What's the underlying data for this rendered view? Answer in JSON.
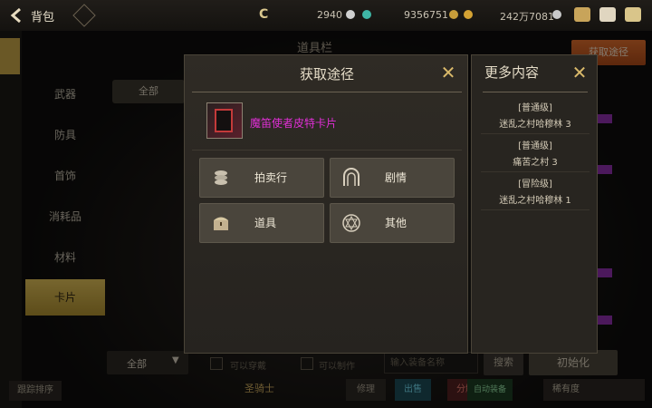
{
  "topbar": {
    "title": "背包",
    "currency_symbol": "C",
    "currencies": [
      {
        "value": "2940",
        "gem_color": "#d0d0d0"
      },
      {
        "value": "9356751",
        "gem_color": "#3fb6a6"
      },
      {
        "value": "242万7081",
        "gem_color": "#d4a233"
      }
    ],
    "icons": [
      "back-arrow-icon",
      "bag-icon",
      "crown-icon",
      "mail-icon",
      "chat-icon"
    ]
  },
  "background": {
    "title": "道具栏",
    "orange_button": "获取途径",
    "sidebar": [
      "武器",
      "防具",
      "首饰",
      "消耗品",
      "材料",
      "卡片"
    ],
    "selected_tab": "卡片",
    "filter": "全部"
  },
  "bottom": {
    "dropdown": "全部",
    "wearable": "可以穿戴",
    "craftable": "可以制作",
    "search_placeholder": "输入装备名称",
    "search_button": "搜索",
    "init_button": "初始化",
    "rank": "跟踪排序",
    "character": "圣骑士",
    "repair": "修理",
    "sell": "出售",
    "decompose": "分解",
    "auto": "自动装备",
    "rarity": "稀有度"
  },
  "dialog": {
    "title": "获取途径",
    "item_name": "魔笛使者皮特卡片",
    "item_name_color": "#e02fd6",
    "sources": [
      {
        "label": "拍卖行",
        "icon": "coin-stack-icon"
      },
      {
        "label": "剧情",
        "icon": "gate-icon"
      },
      {
        "label": "道具",
        "icon": "treasure-chest-icon"
      },
      {
        "label": "其他",
        "icon": "star-circle-icon"
      }
    ]
  },
  "panel": {
    "title": "更多内容",
    "entries": [
      {
        "level": "[普通级]",
        "location": "迷乱之村哈穆林 3"
      },
      {
        "level": "[普通级]",
        "location": "痛苦之村 3"
      },
      {
        "level": "[冒险级]",
        "location": "迷乱之村哈穆林 1"
      }
    ]
  }
}
